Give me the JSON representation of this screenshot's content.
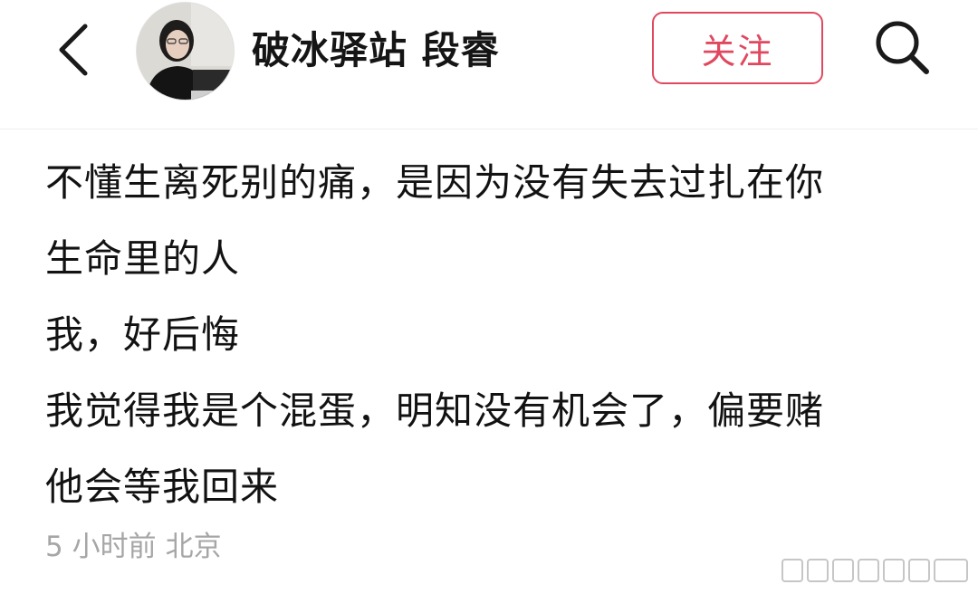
{
  "header": {
    "username": "破冰驿站 段睿",
    "follow_label": "关注",
    "back_icon": "chevron-left-icon",
    "search_icon": "search-icon",
    "accent_color": "#e0485f"
  },
  "post": {
    "lines": [
      "不懂生离死别的痛，是因为没有失去过扎在你",
      "生命里的人",
      "我，好后悔",
      "我觉得我是个混蛋，明知没有机会了，偏要赌",
      "他会等我回来"
    ]
  },
  "meta": {
    "time": "5 小时前",
    "location": "北京"
  }
}
